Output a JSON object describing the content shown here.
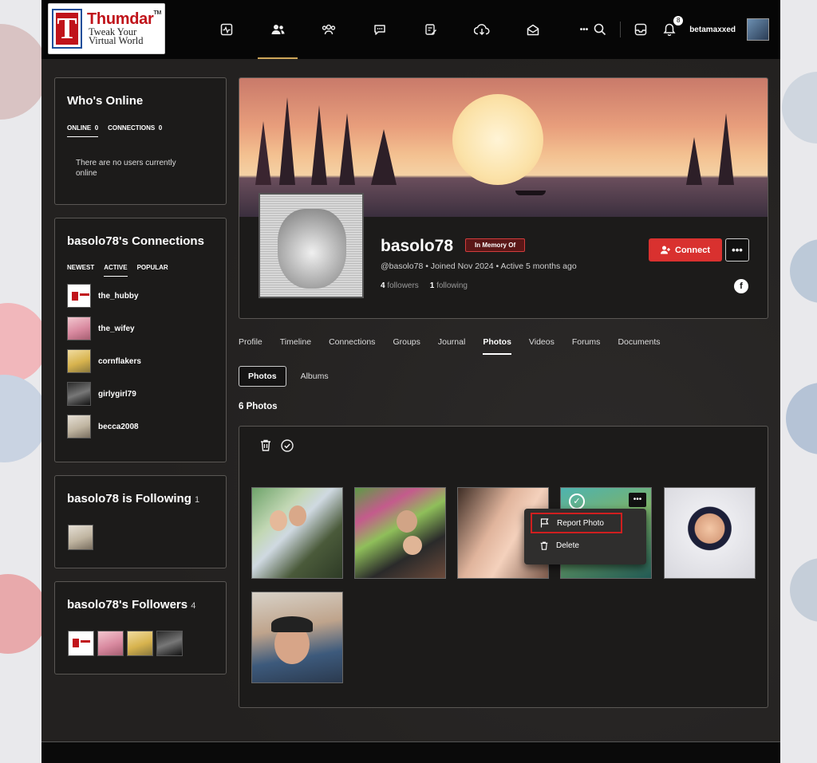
{
  "header": {
    "logo": {
      "mark": "T",
      "brand": "Thumdar",
      "tm": "TM",
      "tagline1": "Tweak Your",
      "tagline2": "Virtual World"
    },
    "nav": [
      {
        "icon": "activity-icon"
      },
      {
        "icon": "members-icon",
        "active": true
      },
      {
        "icon": "groups-icon"
      },
      {
        "icon": "forums-icon"
      },
      {
        "icon": "journal-icon"
      },
      {
        "icon": "download-icon"
      },
      {
        "icon": "messages-icon"
      },
      {
        "icon": "more-icon",
        "label": "•••"
      }
    ],
    "notification_count": "8",
    "username": "betamaxxed"
  },
  "sidebar": {
    "online": {
      "title": "Who's Online",
      "tabs": [
        {
          "label": "ONLINE",
          "count": "0"
        },
        {
          "label": "CONNECTIONS",
          "count": "0"
        }
      ],
      "empty_text": "There are no users currently online"
    },
    "connections": {
      "title": "basolo78's Connections",
      "tabs": [
        "NEWEST",
        "ACTIVE",
        "POPULAR"
      ],
      "active_tab": "ACTIVE",
      "items": [
        {
          "name": "the_hubby"
        },
        {
          "name": "the_wifey"
        },
        {
          "name": "cornflakers"
        },
        {
          "name": "girlygirl79"
        },
        {
          "name": "becca2008"
        }
      ]
    },
    "following": {
      "title": "basolo78 is Following",
      "count": "1"
    },
    "followers": {
      "title": "basolo78's Followers",
      "count": "4"
    }
  },
  "profile": {
    "name": "basolo78",
    "badge": "In Memory Of",
    "meta": "@basolo78 • Joined Nov 2024 • Active 5 months ago",
    "followers_count": "4",
    "followers_label": "followers",
    "following_count": "1",
    "following_label": "following",
    "connect_label": "Connect",
    "more_label": "•••",
    "social": "f"
  },
  "tabs": [
    "Profile",
    "Timeline",
    "Connections",
    "Groups",
    "Journal",
    "Photos",
    "Videos",
    "Forums",
    "Documents"
  ],
  "active_tab": "Photos",
  "subtabs": [
    "Photos",
    "Albums"
  ],
  "photo_count": "6 Photos",
  "context_menu": {
    "report": "Report Photo",
    "delete": "Delete"
  },
  "colors": {
    "accent_red": "#d9312f",
    "nav_underline": "#cfa75a",
    "page_bg": "#232120"
  }
}
